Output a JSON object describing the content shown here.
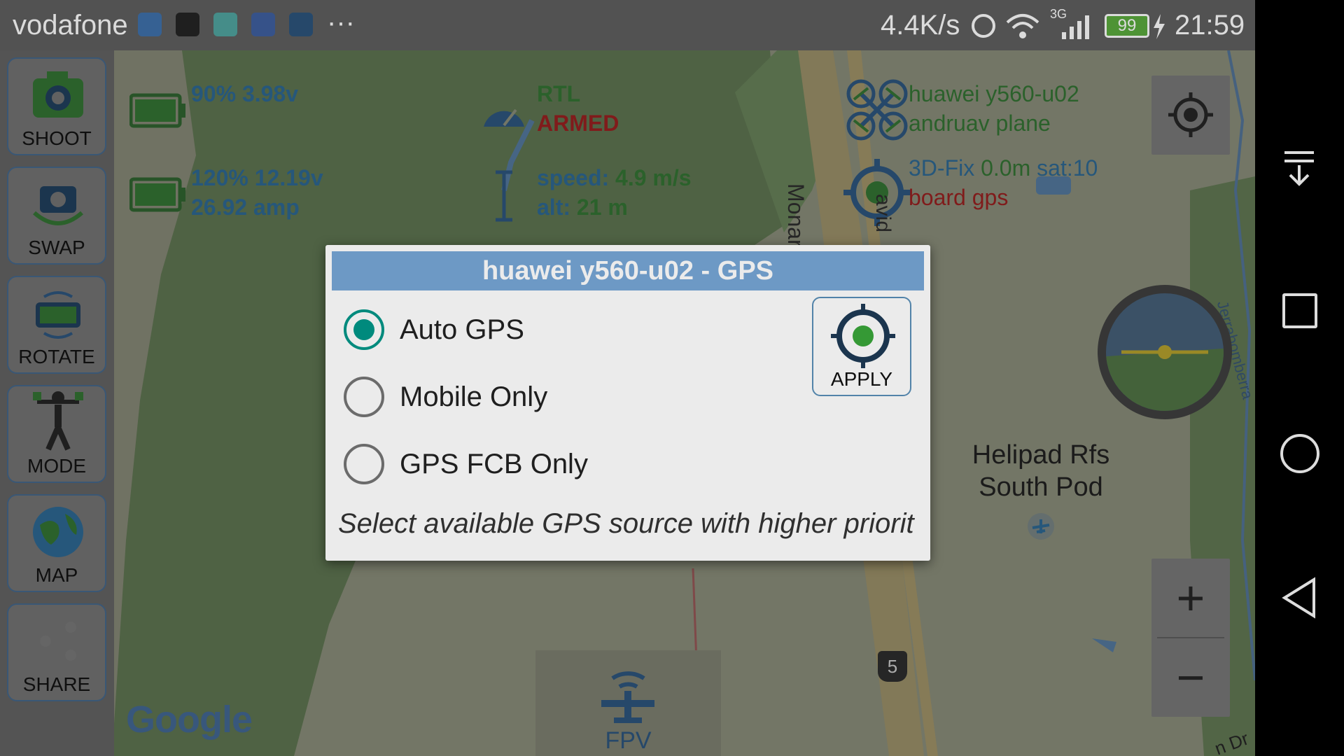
{
  "status_bar": {
    "carrier": "vodafone",
    "more": "···",
    "net_speed": "4.4K/s",
    "network": "3G",
    "battery": "99",
    "time": "21:59"
  },
  "toolbar": {
    "shoot": "SHOOT",
    "swap": "SWAP",
    "rotate": "ROTATE",
    "mode": "MODE",
    "map": "MAP",
    "share": "SHARE"
  },
  "telemetry": {
    "battery1": "90% 3.98v",
    "battery2_line1": "120% 12.19v",
    "battery2_line2": "26.92 amp",
    "flight_mode": "RTL",
    "arm_state": "ARMED",
    "speed_label": "speed:",
    "speed_value": "4.9 m/s",
    "alt_label": "alt:",
    "alt_value": "21 m",
    "vehicle_name": "huawei y560-u02",
    "vehicle_type": "andruav plane",
    "gps_fix": "3D-Fix",
    "gps_alt": "0.0m",
    "gps_sat": "sat:10",
    "gps_source": "board gps"
  },
  "map": {
    "road1": "Monar",
    "road2": "avid",
    "poi_line1": "Helipad Rfs",
    "poi_line2": "South Pod",
    "creek": "Jerrabomberra Creek",
    "route_shield": "5",
    "corner_road": "n Dr",
    "google": "Google",
    "fpv": "FPV",
    "zoom_in": "+",
    "zoom_out": "−"
  },
  "dialog": {
    "title": "huawei y560-u02 - GPS",
    "options": [
      {
        "label": "Auto GPS",
        "checked": true
      },
      {
        "label": "Mobile Only",
        "checked": false
      },
      {
        "label": "GPS FCB Only",
        "checked": false
      }
    ],
    "apply": "APPLY",
    "hint": "Select available GPS source with higher priorit"
  },
  "colors": {
    "dialog_title_bg": "#77a6d6",
    "radio_accent": "#009688",
    "armed_red": "#8b1e1e"
  }
}
